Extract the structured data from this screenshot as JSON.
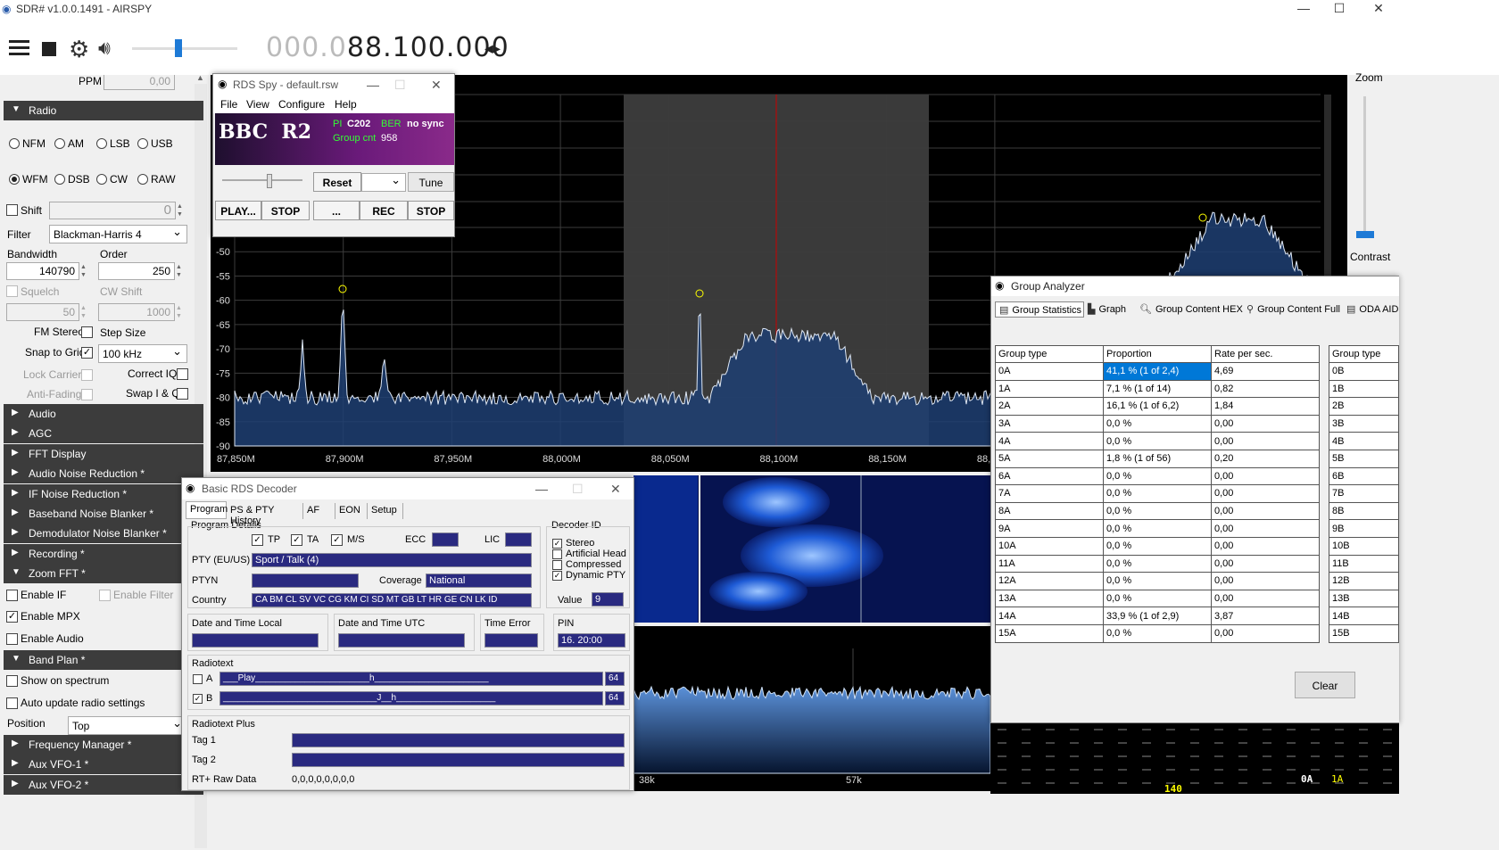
{
  "window": {
    "title": "SDR# v1.0.0.1491 - AIRSPY",
    "min": "—",
    "max": "☐",
    "close": "✕"
  },
  "toolbar": {
    "freq_dim": "000.0",
    "freq_main": "88.100.000",
    "ppm_label": "PPM",
    "ppm_value": "0,00"
  },
  "radio": {
    "section": "Radio",
    "modes_row1": [
      "NFM",
      "AM",
      "LSB",
      "USB"
    ],
    "modes_row2": [
      "WFM",
      "DSB",
      "CW",
      "RAW"
    ],
    "selected_mode": "WFM",
    "shift_label": "Shift",
    "shift_value": "0",
    "filter_label": "Filter",
    "filter_value": "Blackman-Harris 4",
    "bandwidth_label": "Bandwidth",
    "bandwidth_value": "140790",
    "order_label": "Order",
    "order_value": "250",
    "squelch_label": "Squelch",
    "squelch_value": "50",
    "cwshift_label": "CW Shift",
    "cwshift_value": "1000",
    "fmstereo_label": "FM Stereo",
    "stepsize_label": "Step Size",
    "snap_label": "Snap to Grid",
    "snap_value": "100 kHz",
    "lockcarrier_label": "Lock Carrier",
    "correctiq_label": "Correct IQ",
    "antifading_label": "Anti-Fading",
    "swapiq_label": "Swap I & Q"
  },
  "sections": [
    "Audio",
    "AGC",
    "FFT Display",
    "Audio Noise Reduction *",
    "IF Noise Reduction *",
    "Baseband Noise Blanker *",
    "Demodulator Noise Blanker *",
    "Recording *",
    "Zoom FFT *"
  ],
  "zoomfft": {
    "enable_if": "Enable IF",
    "enable_filter": "Enable Filter",
    "enable_mpx": "Enable MPX",
    "enable_audio": "Enable Audio"
  },
  "bandplan": {
    "section": "Band Plan *",
    "show": "Show on spectrum",
    "auto": "Auto update radio settings",
    "position_label": "Position",
    "position_value": "Top"
  },
  "sections2": [
    "Frequency Manager *",
    "Aux VFO-1 *",
    "Aux VFO-2 *"
  ],
  "spectrum": {
    "y_ticks": [
      "-45",
      "-50",
      "-55",
      "-60",
      "-65",
      "-70",
      "-75",
      "-80",
      "-85",
      "-90"
    ],
    "x_ticks": [
      "87,850M",
      "87,900M",
      "87,950M",
      "88,000M",
      "88,050M",
      "88,100M",
      "88,150M",
      "88,"
    ],
    "zoom_label": "Zoom",
    "contrast_label": "Contrast"
  },
  "rdsspy": {
    "title": "RDS Spy - default.rsw",
    "menu": [
      "File",
      "View",
      "Configure",
      "Help"
    ],
    "ps": "BBC  R2",
    "pi_label": "PI",
    "pi_value": "C202",
    "ber_label": "BER",
    "ber_value": "no sync",
    "groupcnt_label": "Group cnt",
    "groupcnt_value": "958",
    "reset": "Reset",
    "tune": "Tune",
    "play": "PLAY...",
    "stop1": "STOP",
    "dots": "...",
    "rec": "REC",
    "stop2": "STOP"
  },
  "rdsdecoder": {
    "title": "Basic RDS Decoder",
    "tabs": [
      "Program",
      "PS & PTY History",
      "AF",
      "EON",
      "Setup"
    ],
    "program_details": "Program Details",
    "tp": "TP",
    "ta": "TA",
    "ms": "M/S",
    "ecc": "ECC",
    "lic": "LIC",
    "pty_label": "PTY (EU/US)",
    "pty_value": "Sport / Talk (4)",
    "ptyn_label": "PTYN",
    "coverage_label": "Coverage",
    "coverage_value": "National",
    "country_label": "Country",
    "country_value": "CA BM CL SV VC CG KM CI SD MT GB LT HR GE CN LK ID",
    "decoder_id": "Decoder ID",
    "stereo": "Stereo",
    "artificial_head": "Artificial Head",
    "compressed": "Compressed",
    "dynamic_pty": "Dynamic PTY",
    "value_label": "Value",
    "value": "9",
    "dt_local": "Date and Time Local",
    "dt_utc": "Date and Time UTC",
    "time_error": "Time Error",
    "pin_label": "PIN",
    "pin_value": "16. 20:00",
    "radiotext": "Radiotext",
    "rt_a": "A",
    "rt_a_text": "___Play_______________________h_______________________",
    "rt_a_num": "64",
    "rt_b": "B",
    "rt_b_text": "_______________________________J__h____________________",
    "rt_b_num": "64",
    "rtplus": "Radiotext Plus",
    "tag1": "Tag 1",
    "tag2": "Tag 2",
    "rtraw_label": "RT+ Raw Data",
    "rtraw_value": "0,0,0,0,0,0,0,0"
  },
  "groupanalyzer": {
    "title": "Group Analyzer",
    "tabs": [
      "Group Statistics",
      "Graph",
      "Group Content HEX",
      "Group Content Full",
      "ODA AID"
    ],
    "headers": [
      "Group type",
      "Proportion",
      "Rate per sec."
    ],
    "header2": "Group type",
    "rows": [
      [
        "0A",
        "41,1 %  (1 of 2,4)",
        "4,69"
      ],
      [
        "1A",
        "7,1 %  (1 of 14)",
        "0,82"
      ],
      [
        "2A",
        "16,1 %  (1 of 6,2)",
        "1,84"
      ],
      [
        "3A",
        "0,0 %",
        "0,00"
      ],
      [
        "4A",
        "0,0 %",
        "0,00"
      ],
      [
        "5A",
        "1,8 %  (1 of 56)",
        "0,20"
      ],
      [
        "6A",
        "0,0 %",
        "0,00"
      ],
      [
        "7A",
        "0,0 %",
        "0,00"
      ],
      [
        "8A",
        "0,0 %",
        "0,00"
      ],
      [
        "9A",
        "0,0 %",
        "0,00"
      ],
      [
        "10A",
        "0,0 %",
        "0,00"
      ],
      [
        "11A",
        "0,0 %",
        "0,00"
      ],
      [
        "12A",
        "0,0 %",
        "0,00"
      ],
      [
        "13A",
        "0,0 %",
        "0,00"
      ],
      [
        "14A",
        "33,9 %  (1 of 2,9)",
        "3,87"
      ],
      [
        "15A",
        "0,0 %",
        "0,00"
      ]
    ],
    "col_b": [
      "0B",
      "1B",
      "2B",
      "3B",
      "4B",
      "5B",
      "6B",
      "7B",
      "8B",
      "9B",
      "10B",
      "11B",
      "12B",
      "13B",
      "14B",
      "15B"
    ],
    "clear": "Clear"
  },
  "lowspec": {
    "x_ticks": [
      "38k",
      "57k"
    ]
  },
  "bottomdark": {
    "a": "140",
    "b": "0A",
    "c": "1A"
  }
}
